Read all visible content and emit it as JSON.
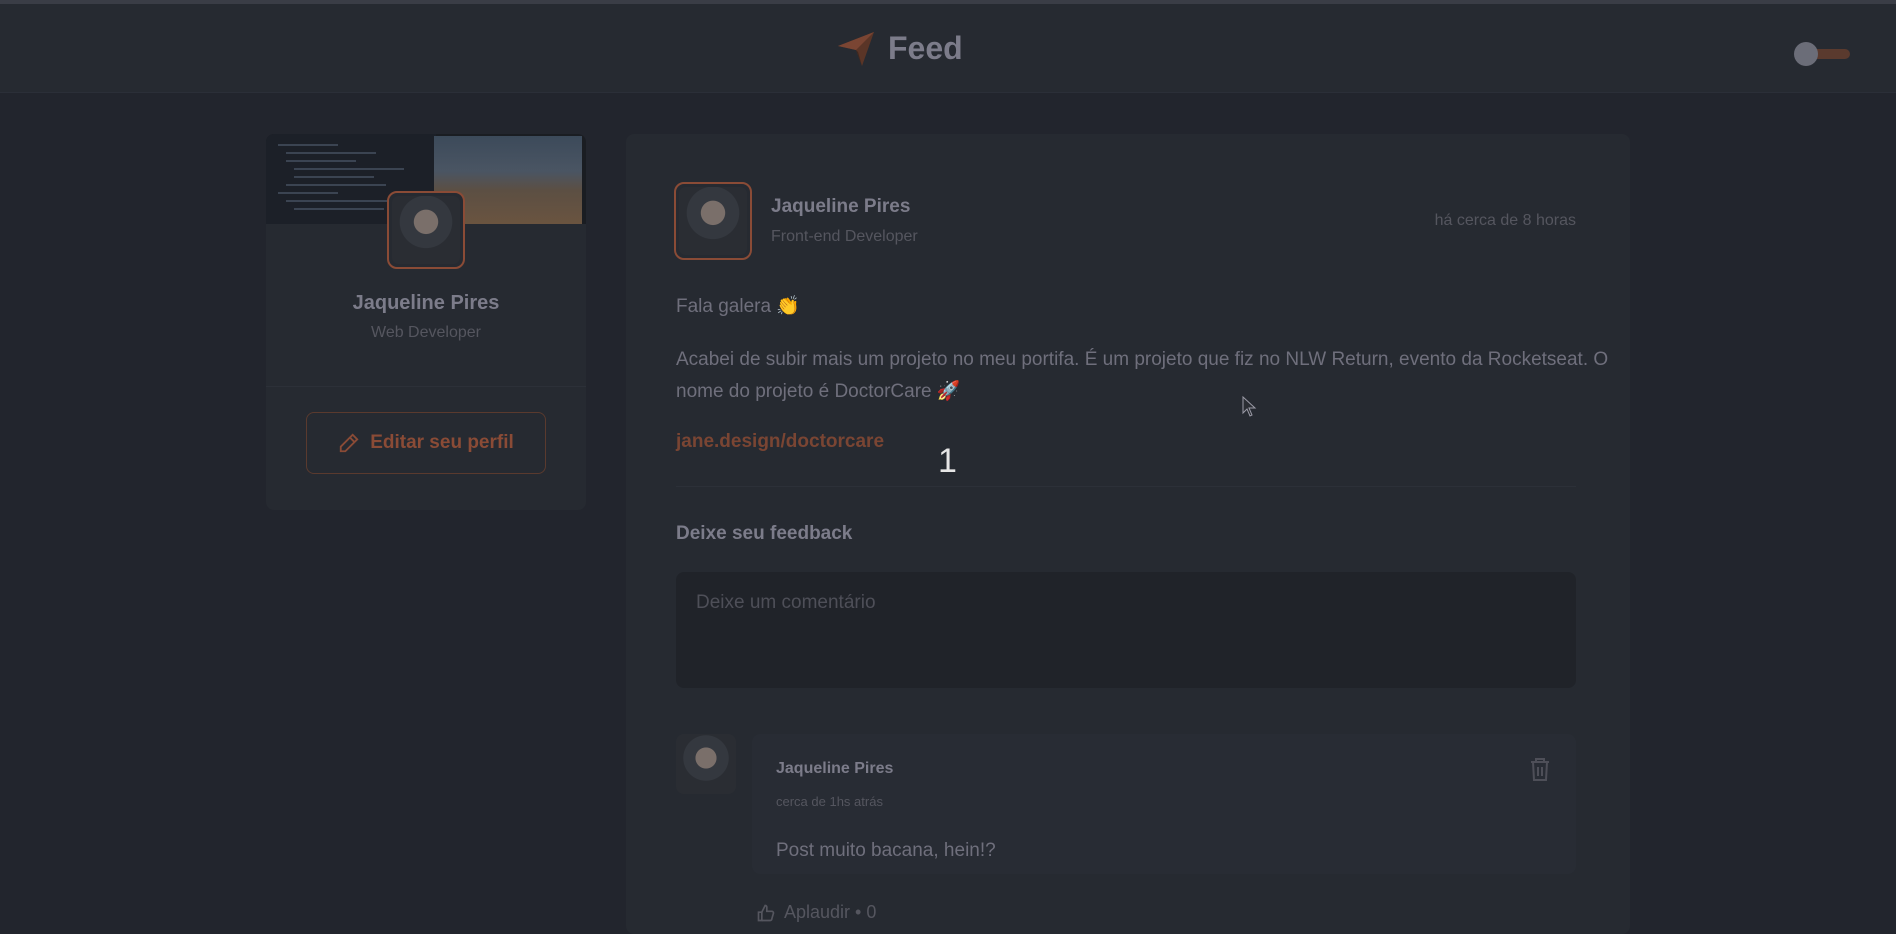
{
  "header": {
    "title": "Feed",
    "logo_icon": "paper-plane-icon",
    "theme_toggle": "dark"
  },
  "profile": {
    "name": "Jaqueline Pires",
    "role": "Web Developer",
    "edit_label": "Editar seu perfil",
    "edit_icon": "pencil-icon"
  },
  "post": {
    "author": "Jaqueline Pires",
    "author_role": "Front-end Developer",
    "time": "há cerca de 8 horas",
    "greeting": "Fala galera 👏",
    "body": "Acabei de subir mais um projeto no meu portifa. É um projeto que fiz no NLW Return, evento da Rocketseat. O nome do projeto é DoctorCare 🚀",
    "link": "jane.design/doctorcare",
    "feedback_title": "Deixe seu feedback",
    "comment_placeholder": "Deixe um comentário"
  },
  "comment": {
    "author": "Jaqueline Pires",
    "time": "cerca de 1hs atrás",
    "text": "Post muito bacana, hein!?",
    "applaud_label": "Aplaudir • 0",
    "delete_icon": "trash-icon"
  },
  "overlay": {
    "number": "1"
  },
  "colors": {
    "background": "#22252d",
    "card": "#262a31",
    "accent": "#8a4b36"
  }
}
